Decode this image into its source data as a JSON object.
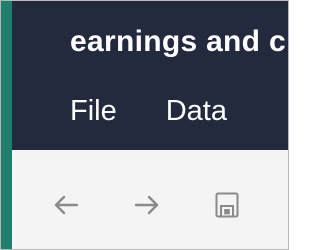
{
  "window": {
    "title": "earnings and c"
  },
  "menubar": {
    "items": [
      {
        "label": "File"
      },
      {
        "label": "Data"
      }
    ]
  },
  "toolbar": {
    "buttons": [
      {
        "icon": "arrow-left-icon",
        "tooltip": ""
      },
      {
        "icon": "arrow-right-icon",
        "tooltip": ""
      },
      {
        "icon": "save-icon",
        "tooltip": ""
      }
    ]
  },
  "colors": {
    "accent": "#1f7f6c",
    "header_bg": "#232a3e",
    "toolbar_bg": "#f4f4f4",
    "icon": "#8a8a8a"
  }
}
